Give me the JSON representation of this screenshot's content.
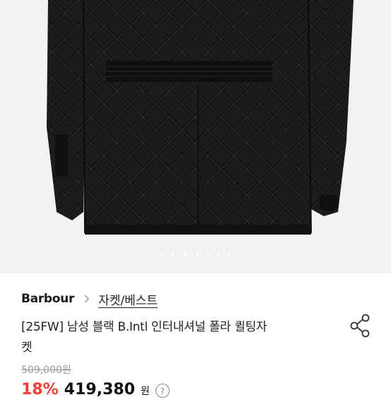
{
  "product_images": {
    "slide_count": 7,
    "active_index": 2,
    "image_description_icon": "quilted-jacket-back-icon"
  },
  "breadcrumb": {
    "brand": "Barbour",
    "category": "자켓/베스트"
  },
  "product": {
    "title_line1": "[25FW] 남성 블랙 B.Intl 인터내셔널 폴라 퀼팅자",
    "title_line2": "켓",
    "original_price": "509,000원",
    "discount": "18%",
    "sale_price": "419,380",
    "sale_unit": "원",
    "coupon_mark": "?"
  },
  "colors": {
    "background_image": "#f2f2f2",
    "jacket": "#151515",
    "discount": "#ff3b30",
    "strike": "#9a9a9a"
  },
  "icons": {
    "share": "share-icon",
    "chevron": "chevron-right-icon"
  }
}
